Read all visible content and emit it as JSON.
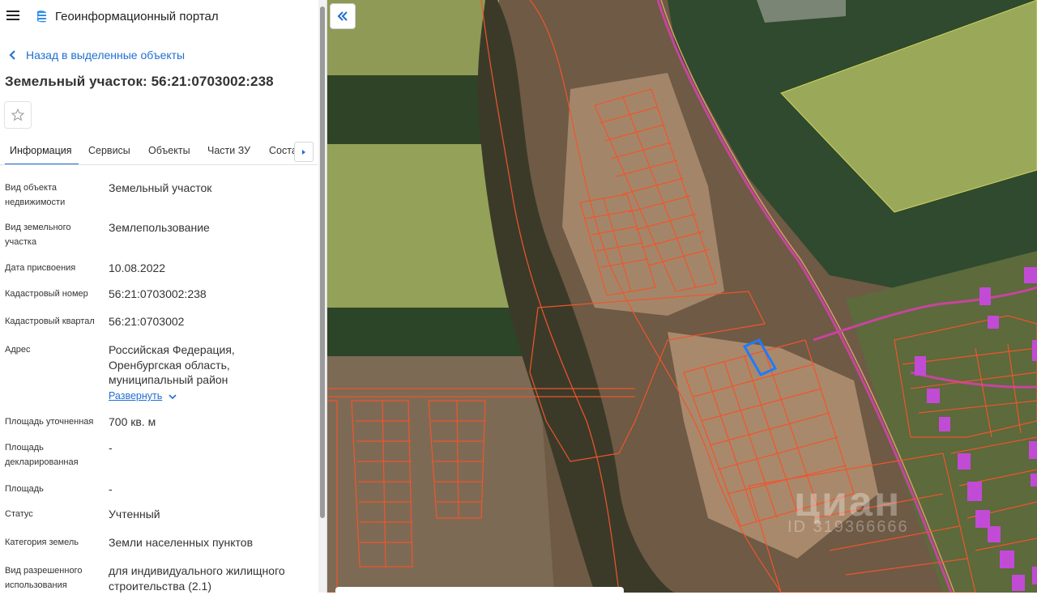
{
  "app": {
    "title": "Геоинформационный портал"
  },
  "nav": {
    "back_label": "Назад в выделенные объекты"
  },
  "object": {
    "title": "Земельный участок: 56:21:0703002:238"
  },
  "tabs": [
    {
      "label": "Информация",
      "active": true
    },
    {
      "label": "Сервисы",
      "active": false
    },
    {
      "label": "Объекты",
      "active": false
    },
    {
      "label": "Части ЗУ",
      "active": false
    },
    {
      "label": "Соста",
      "active": false
    }
  ],
  "properties": [
    {
      "label": "Вид объекта недвижимости",
      "value": "Земельный участок"
    },
    {
      "label": "Вид земельного участка",
      "value": "Землепользование"
    },
    {
      "label": "Дата присвоения",
      "value": "10.08.2022"
    },
    {
      "label": "Кадастровый номер",
      "value": "56:21:0703002:238"
    },
    {
      "label": "Кадастровый квартал",
      "value": "56:21:0703002"
    },
    {
      "label": "Адрес",
      "value": "Российская Федерация, Оренбургская область, муниципальный район"
    },
    {
      "label": "Площадь уточненная",
      "value": "700 кв. м"
    },
    {
      "label": "Площадь декларированная",
      "value": "-"
    },
    {
      "label": "Площадь",
      "value": "-"
    },
    {
      "label": "Статус",
      "value": "Учтенный"
    },
    {
      "label": "Категория земель",
      "value": "Земли населенных пунктов"
    },
    {
      "label": "Вид разрешенного использования",
      "value": "для индивидуального жилищного строительства (2.1)"
    }
  ],
  "expand_label": "Развернуть",
  "map": {
    "watermark": "циан",
    "watermark_id": "ID 319366666"
  },
  "colors": {
    "accent": "#1f6fd1",
    "parcel_outline": "#f0552c",
    "selected_parcel": "#1e7bff",
    "field_green": "#8c9a4e",
    "forest": "#2f4a2a",
    "bare_soil": "#8e7357",
    "road_line": "#d43ea5",
    "building": "#c24bd6"
  }
}
